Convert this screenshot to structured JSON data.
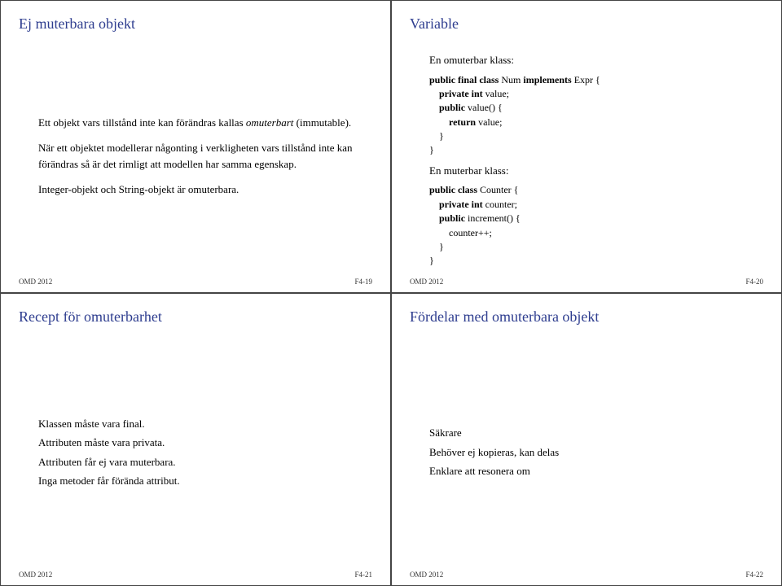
{
  "panels": {
    "tl": {
      "title": "Ej muterbara objekt",
      "p1a": "Ett objekt vars tillstånd inte kan förändras kallas ",
      "p1b": "omuterbart",
      "p1c": " (immutable).",
      "p2": "När ett objektet modellerar någonting i verkligheten vars tillstånd inte kan förändras så är det rimligt att modellen har samma egenskap.",
      "p3": "Integer-objekt och String-objekt är omuterbara.",
      "footL": "OMD 2012",
      "footR": "F4-19"
    },
    "tr": {
      "title": "Variable",
      "sub1": "En omuterbar klass:",
      "c1_l1a": "public final class ",
      "c1_l1b": "Num ",
      "c1_l1c": "implements ",
      "c1_l1d": "Expr {",
      "c1_l2a": "    private int ",
      "c1_l2b": "value;",
      "c1_l3a": "    public ",
      "c1_l3b": "value() {",
      "c1_l4a": "        return ",
      "c1_l4b": "value;",
      "c1_l5": "    }",
      "c1_l6": "}",
      "sub2": "En muterbar klass:",
      "c2_l1a": "public class ",
      "c2_l1b": "Counter {",
      "c2_l2a": "    private int ",
      "c2_l2b": "counter;",
      "c2_l3a": "    public ",
      "c2_l3b": "increment() {",
      "c2_l4": "        counter++;",
      "c2_l5": "    }",
      "c2_l6": "}",
      "footL": "OMD 2012",
      "footR": "F4-20"
    },
    "bl": {
      "title": "Recept för omuterbarhet",
      "i1": "Klassen måste vara final.",
      "i2": "Attributen måste vara privata.",
      "i3": "Attributen får ej vara muterbara.",
      "i4": "Inga metoder får förända attribut.",
      "footL": "OMD 2012",
      "footR": "F4-21"
    },
    "br": {
      "title": "Fördelar med omuterbara objekt",
      "i1": "Säkrare",
      "i2": "Behöver ej kopieras, kan delas",
      "i3": "Enklare att resonera om",
      "footL": "OMD 2012",
      "footR": "F4-22"
    }
  }
}
